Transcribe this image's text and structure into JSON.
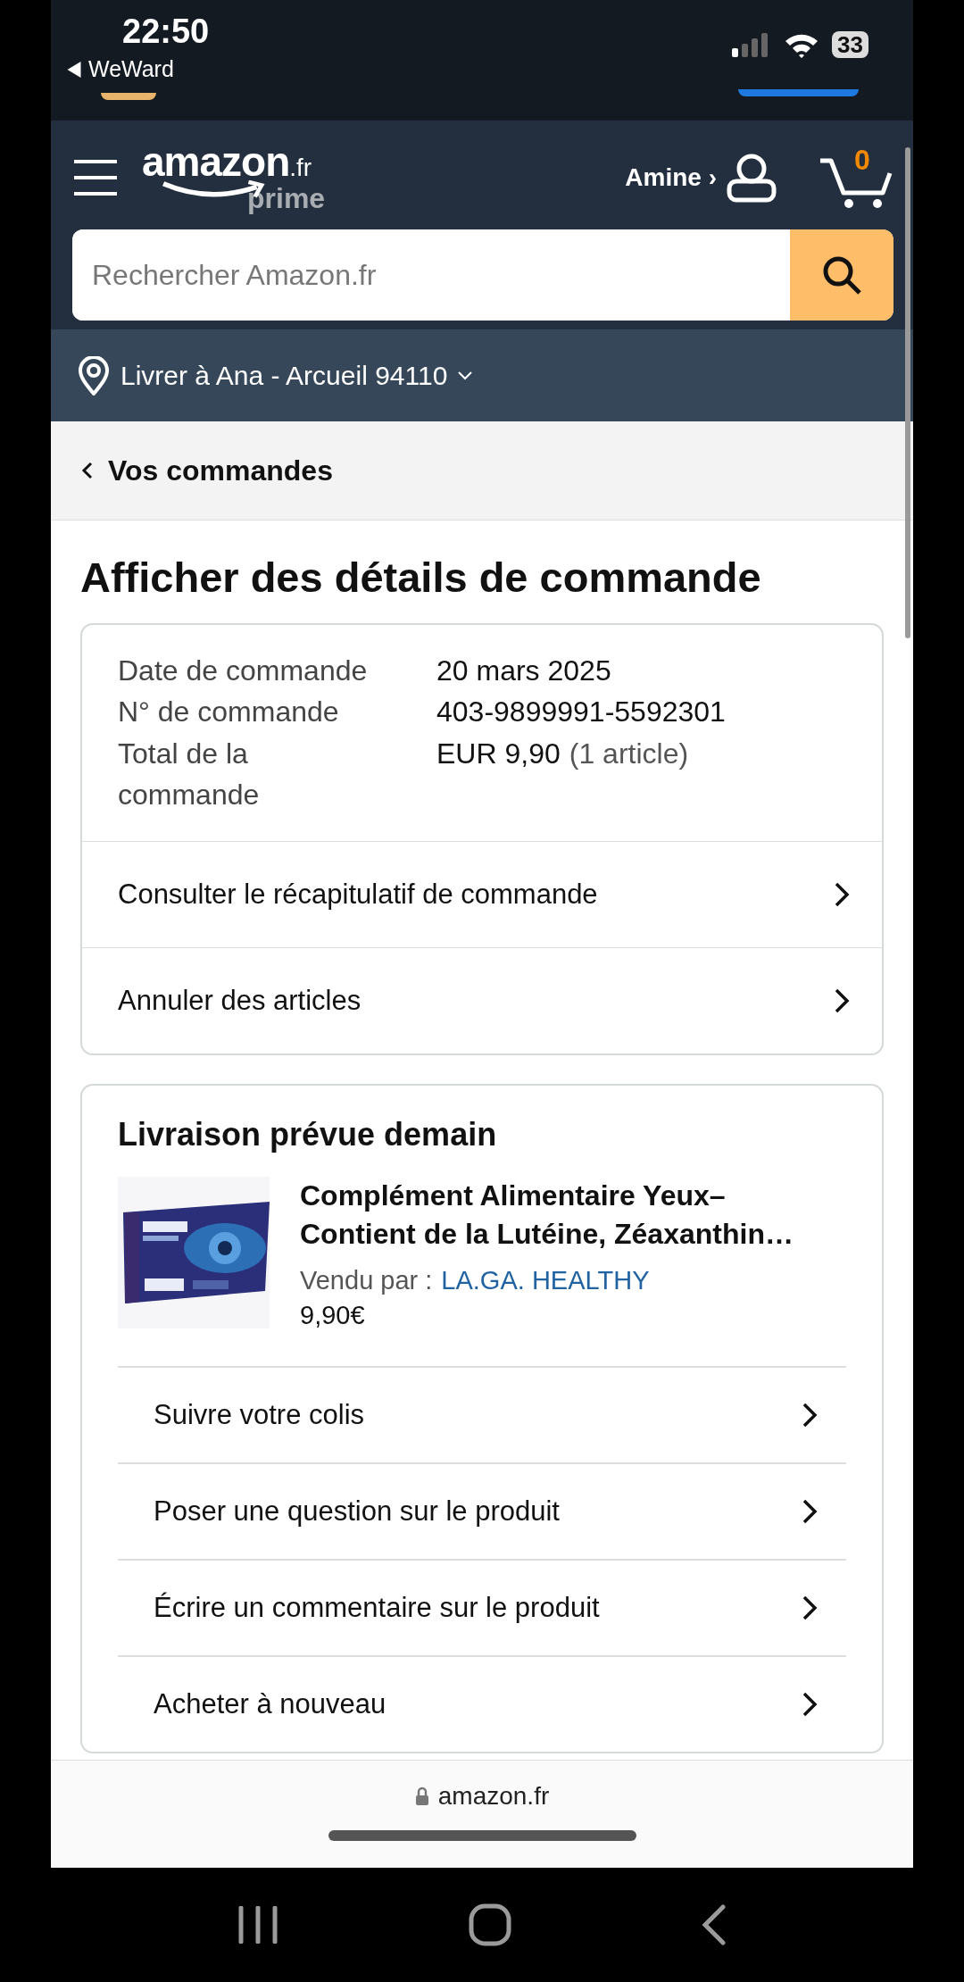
{
  "status_bar": {
    "time": "22:50",
    "back_app": "WeWard",
    "battery": "33"
  },
  "header": {
    "logo": "amazon",
    "logo_domain": ".fr",
    "logo_tier": "prime",
    "account": "Amine ›",
    "cart_count": "0"
  },
  "search": {
    "placeholder": "Rechercher Amazon.fr"
  },
  "location": {
    "text": "Livrer à Ana - Arcueil 94110"
  },
  "breadcrumb": {
    "label": "Vos commandes"
  },
  "title": "Afficher des détails de commande",
  "order_info": [
    {
      "label": "Date de commande",
      "value": "20 mars 2025"
    },
    {
      "label": "N° de commande",
      "value": "403-9899991-5592301"
    },
    {
      "label": "Total de la commande",
      "value": "EUR 9,90",
      "note": "(1 article)"
    }
  ],
  "order_actions": [
    "Consulter le récapitulatif de commande",
    "Annuler des articles"
  ],
  "shipment": {
    "heading": "Livraison prévue demain",
    "product": {
      "title": "Complément Alimentaire Yeux– Contient de la Lutéine, Zéaxanthin…",
      "sold_by_label": "Vendu par  :",
      "seller": "LA.GA. HEALTHY",
      "price": "9,90€"
    },
    "actions": [
      "Suivre votre colis",
      "Poser une question sur le produit",
      "Écrire un commentaire sur le produit",
      "Acheter à nouveau"
    ]
  },
  "browser_bar": {
    "url": "amazon.fr"
  }
}
